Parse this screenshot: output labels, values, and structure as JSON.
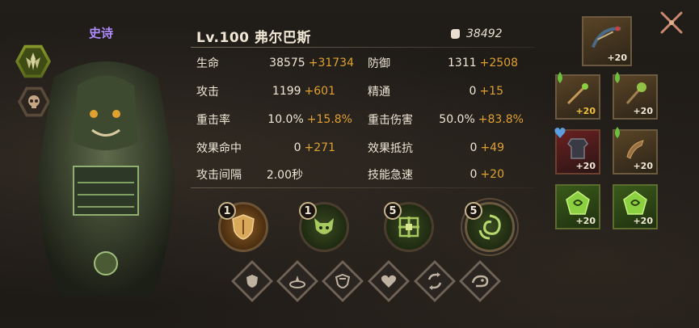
{
  "rarity": "史诗",
  "hero": {
    "level_name": "Lv.100  弗尔巴斯",
    "power": "38492"
  },
  "stats_left": [
    {
      "label": "生命",
      "base": "38575",
      "bonus": "+31734"
    },
    {
      "label": "攻击",
      "base": "1199",
      "bonus": "+601"
    },
    {
      "label": "重击率",
      "base": "10.0%",
      "bonus": "+15.8%"
    },
    {
      "label": "效果命中",
      "base": "0",
      "bonus": "+271"
    },
    {
      "label": "攻击间隔",
      "base": "2.00秒",
      "bonus": ""
    }
  ],
  "stats_right": [
    {
      "label": "防御",
      "base": "1311",
      "bonus": "+2508"
    },
    {
      "label": "精通",
      "base": "0",
      "bonus": "+15"
    },
    {
      "label": "重击伤害",
      "base": "50.0%",
      "bonus": "+83.8%"
    },
    {
      "label": "效果抵抗",
      "base": "0",
      "bonus": "+49"
    },
    {
      "label": "技能急速",
      "base": "0",
      "bonus": "+20"
    }
  ],
  "skills": [
    {
      "level": "1",
      "icon": "shield-skill-icon"
    },
    {
      "level": "1",
      "icon": "demon-face-skill-icon"
    },
    {
      "level": "5",
      "icon": "cross-rune-skill-icon"
    },
    {
      "level": "5",
      "icon": "swirl-skill-icon"
    }
  ],
  "equipment": [
    {
      "plus": "+20",
      "icon": "bow-weapon-icon"
    },
    {
      "plus": "+20",
      "icon": "rod-icon"
    },
    {
      "plus": "+20",
      "icon": "staff-icon"
    },
    {
      "plus": "+20",
      "icon": "armor-icon"
    },
    {
      "plus": "+20",
      "icon": "horn-icon"
    },
    {
      "plus": "+20",
      "icon": "green-rune-icon"
    },
    {
      "plus": "+20",
      "icon": "green-rune-icon"
    }
  ],
  "colors": {
    "bonus": "#e0a030",
    "rarity": "#b08cff",
    "accent_green": "#8a9a2a"
  }
}
